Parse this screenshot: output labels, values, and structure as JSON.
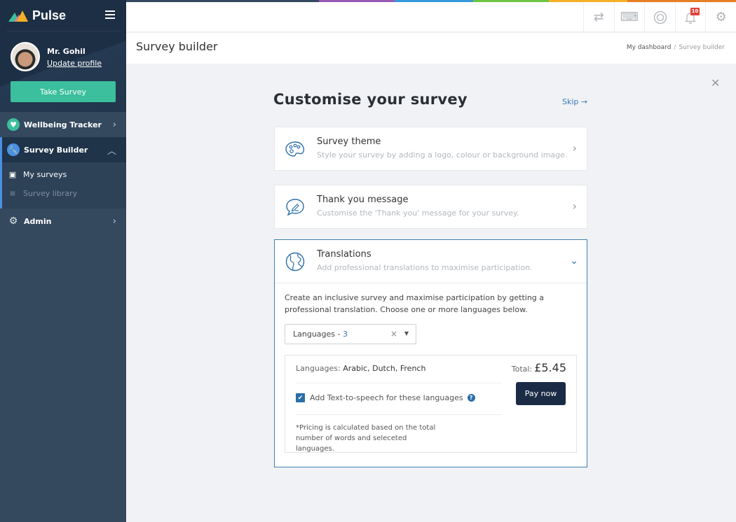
{
  "brand": {
    "name": "Pulse"
  },
  "user": {
    "name": "Mr. Gohil",
    "update_profile": "Update profile"
  },
  "sidebar": {
    "take_survey": "Take Survey",
    "items": [
      {
        "label": "Wellbeing Tracker",
        "icon": "heart-icon",
        "expanded": false
      },
      {
        "label": "Survey Builder",
        "icon": "wrench-icon",
        "expanded": true,
        "children": [
          {
            "label": "My surveys",
            "icon": "clipboard-icon",
            "active": true
          },
          {
            "label": "Survey library",
            "icon": "layers-icon",
            "active": false
          }
        ]
      },
      {
        "label": "Admin",
        "icon": "gear-icon",
        "expanded": false
      }
    ]
  },
  "topbar": {
    "rainbow_colors": [
      "#34495e",
      "#9b59b6",
      "#3498db",
      "#6cc644",
      "#f5b025",
      "#e67e22"
    ],
    "icons": [
      {
        "name": "swap-icon",
        "glyph": "⇄"
      },
      {
        "name": "keyboard-icon",
        "glyph": "⌨"
      },
      {
        "name": "help-lifebuoy-icon",
        "glyph": "◎"
      },
      {
        "name": "bell-icon",
        "glyph": "🔔",
        "badge": "10"
      },
      {
        "name": "settings-icon",
        "glyph": "⚙"
      }
    ]
  },
  "page": {
    "title": "Survey builder",
    "breadcrumb": [
      "My dashboard",
      "Survey builder"
    ]
  },
  "content": {
    "heading": "Customise your survey",
    "skip": "Skip →",
    "close": "✕",
    "cards": [
      {
        "title": "Survey theme",
        "subtitle": "Style your survey by adding a logo, colour or background image.",
        "icon": "palette-icon"
      },
      {
        "title": "Thank you message",
        "subtitle": "Customise the 'Thank you' message for your survey.",
        "icon": "chat-edit-icon"
      },
      {
        "title": "Translations",
        "subtitle": "Add professional translations to maximise participation.",
        "icon": "globe-icon",
        "expanded": true
      }
    ],
    "translations": {
      "description": "Create an inclusive survey and maximise participation by getting a professional translation. Choose one or more languages below.",
      "select_label": "Languages - ",
      "select_count": "3",
      "languages_label": "Languages: ",
      "languages": "Arabic, Dutch, French",
      "tts_label": "Add Text-to-speech for these languages",
      "tts_checked": true,
      "note": "*Pricing is calculated based on the total number of words and seleceted languages.",
      "total_label": "Total:",
      "total_amount": "£5.45",
      "pay_button": "Pay now"
    }
  }
}
